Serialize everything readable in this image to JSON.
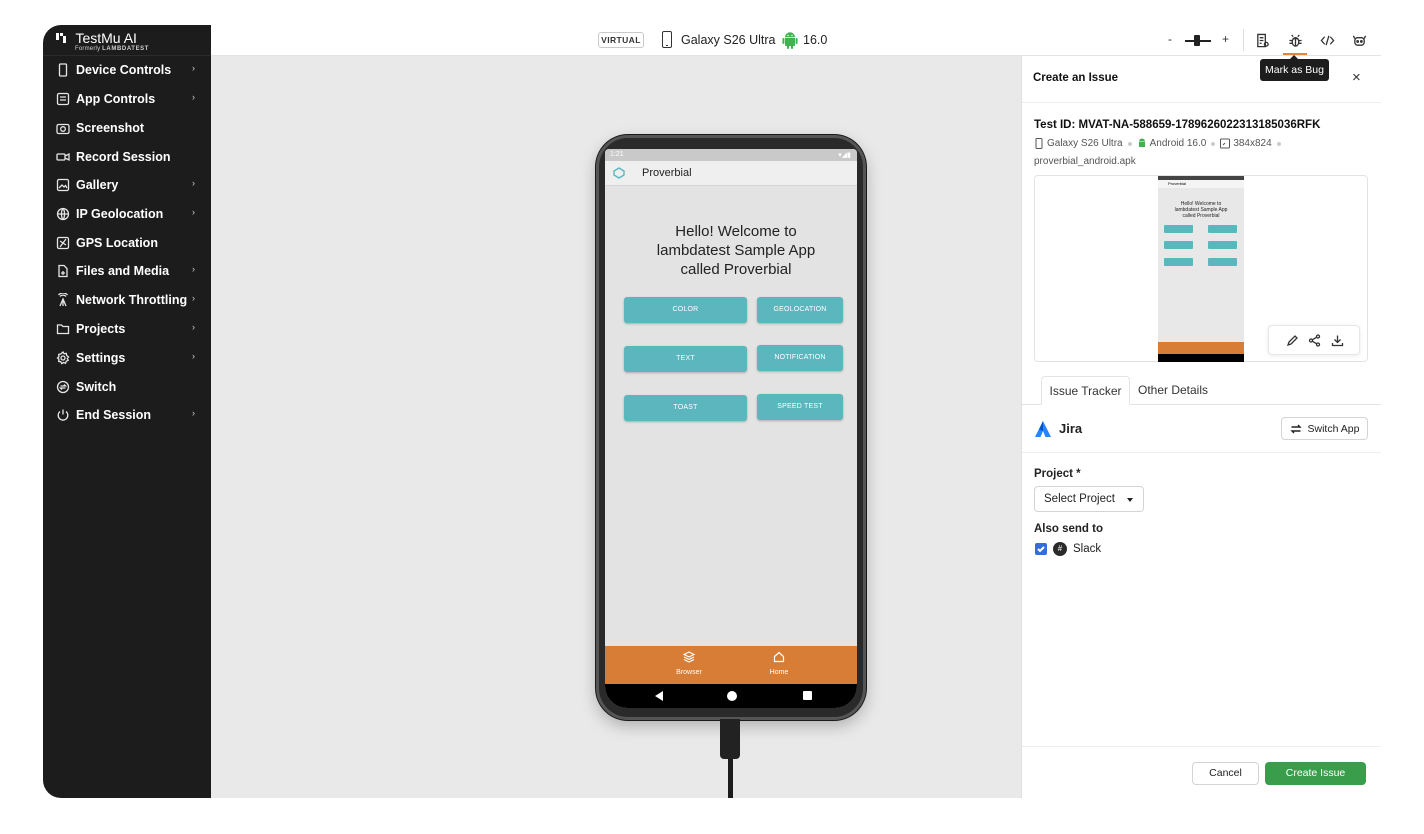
{
  "brand": {
    "name": "TestMu AI",
    "formerly_prefix": "Formerly",
    "formerly_name": "LAMBDATEST"
  },
  "sidebar": {
    "items": [
      {
        "label": "Device Controls",
        "icon": "phone-icon",
        "has_submenu": true
      },
      {
        "label": "App Controls",
        "icon": "app-grid-icon",
        "has_submenu": true
      },
      {
        "label": "Screenshot",
        "icon": "camera-icon",
        "has_submenu": false
      },
      {
        "label": "Record Session",
        "icon": "video-icon",
        "has_submenu": false
      },
      {
        "label": "Gallery",
        "icon": "gallery-icon",
        "has_submenu": true
      },
      {
        "label": "IP Geolocation",
        "icon": "globe-icon",
        "has_submenu": true
      },
      {
        "label": "GPS Location",
        "icon": "map-pin-icon",
        "has_submenu": false
      },
      {
        "label": "Files and Media",
        "icon": "file-icon",
        "has_submenu": true
      },
      {
        "label": "Network Throttling",
        "icon": "antenna-icon",
        "has_submenu": true
      },
      {
        "label": "Projects",
        "icon": "folder-icon",
        "has_submenu": true
      },
      {
        "label": "Settings",
        "icon": "gear-icon",
        "has_submenu": true
      },
      {
        "label": "Switch",
        "icon": "switch-icon",
        "has_submenu": false
      },
      {
        "label": "End Session",
        "icon": "power-icon",
        "has_submenu": true
      }
    ],
    "chevron": "›"
  },
  "topbar": {
    "badge": "VIRTUAL",
    "device_name": "Galaxy S26 Ultra",
    "os_version": "16.0",
    "zoom_minus": "-",
    "zoom_plus": "+",
    "tooltip": "Mark as Bug",
    "active_tool": "bug-icon"
  },
  "device_screen": {
    "status_time": "1:21",
    "app_title": "Proverbial",
    "welcome": "Hello! Welcome to lambdatest Sample App called Proverbial",
    "buttons": [
      "COLOR",
      "GEOLOCATION",
      "TEXT",
      "NOTIFICATION",
      "TOAST",
      "SPEED TEST"
    ],
    "bottom_nav": [
      "Browser",
      "Home"
    ]
  },
  "panel": {
    "title": "Create an Issue",
    "close": "×",
    "test_id": "Test ID: MVAT-NA-588659-1789626022313185036RFK",
    "meta_device": "Galaxy S26 Ultra",
    "meta_os": "Android 16.0",
    "meta_resolution": "384x824",
    "apk": "proverbial_android.apk",
    "preview_mini_title": "Proverbial",
    "preview_mini_welcome": "Hello! Welcome to lambdatest Sample App called Proverbial",
    "tabs": [
      "Issue Tracker",
      "Other Details"
    ],
    "tracker_name": "Jira",
    "switch_app": "Switch App",
    "project_label": "Project *",
    "project_placeholder": "Select Project",
    "also_send_label": "Also send to",
    "slack_label": "Slack",
    "slack_checked": true,
    "cancel": "Cancel",
    "create": "Create Issue"
  },
  "colors": {
    "accent_orange": "#e8823a",
    "teal_button": "#5bb6be",
    "primary_green": "#3a9d4b",
    "checkbox_blue": "#2f6fd6"
  }
}
